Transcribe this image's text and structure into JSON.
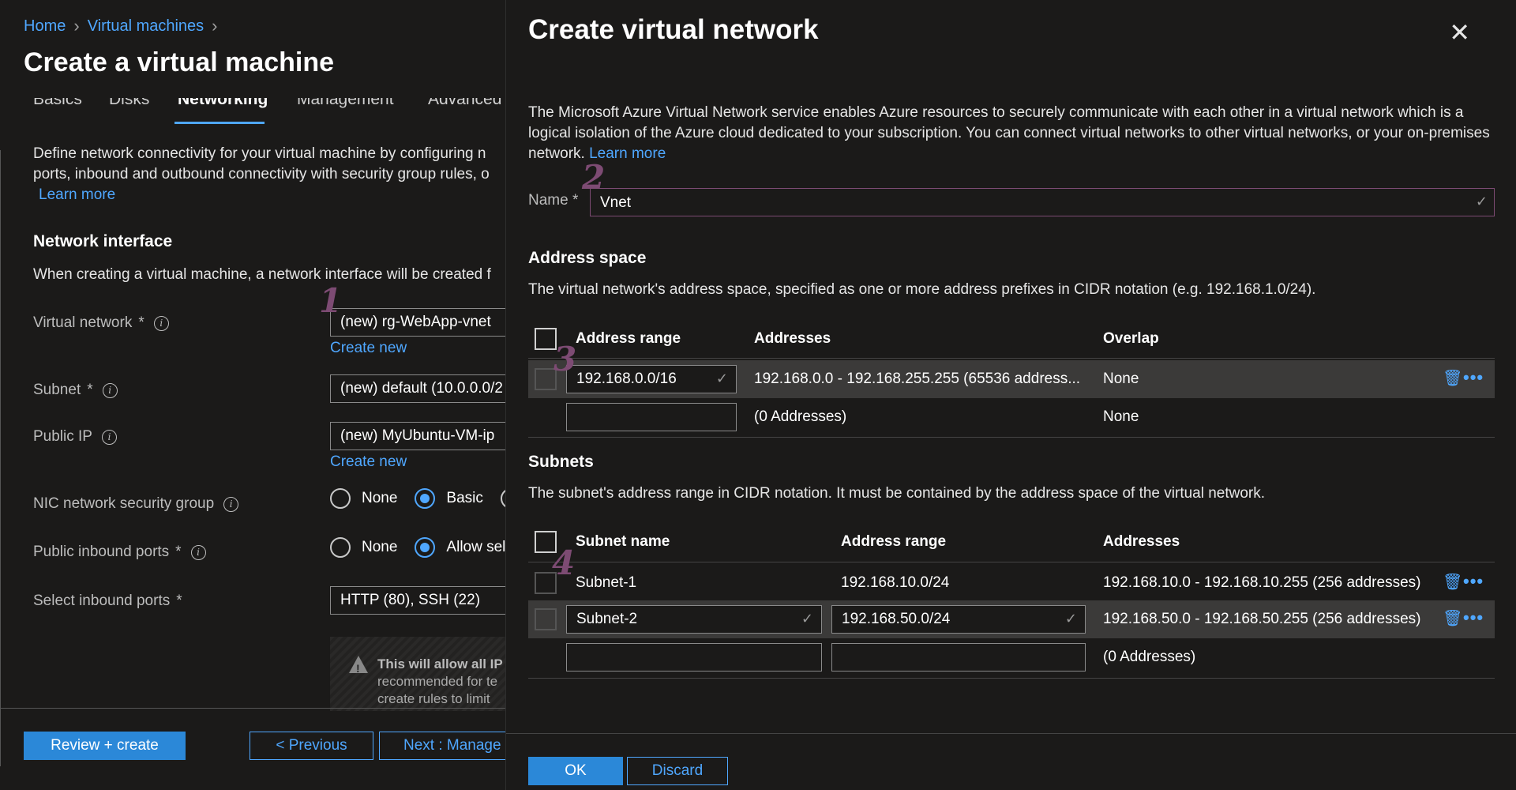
{
  "breadcrumb": {
    "home": "Home",
    "vms": "Virtual machines",
    "sep1": "›",
    "sep2": "›"
  },
  "left": {
    "title": "Create a virtual machine",
    "tabs": [
      "Basics",
      "Disks",
      "Networking",
      "Management",
      "Advanced"
    ],
    "desc_line1": "Define network connectivity for your virtual machine by configuring n",
    "desc_line2": "ports, inbound and outbound connectivity with security group rules, o",
    "learn_more": "Learn more",
    "network_interface_title": "Network interface",
    "network_interface_text": "When creating a virtual machine, a network interface will be created f",
    "fields": {
      "vnet_label": "Virtual network",
      "vnet_value": "(new) rg-WebApp-vnet",
      "subnet_label": "Subnet",
      "subnet_value": "(new) default (10.0.0.0/2",
      "pip_label": "Public IP",
      "pip_value": "(new) MyUbuntu-VM-ip",
      "nsg_label": "NIC network security group",
      "nsg_none": "None",
      "nsg_basic": "Basic",
      "inbound_label": "Public inbound ports",
      "inbound_none": "None",
      "inbound_allow": "Allow sel",
      "select_ports_label": "Select inbound ports",
      "select_ports_value": "HTTP (80), SSH (22)",
      "required_mark": "*",
      "create_new": "Create new"
    },
    "warning": {
      "title": "This will allow all IP",
      "line2": "recommended for te",
      "line3": "create rules to limit"
    },
    "buttons": {
      "review": "Review + create",
      "previous": "< Previous",
      "next": "Next : Manage"
    }
  },
  "annotations": [
    "1",
    "2",
    "3",
    "4"
  ],
  "panel": {
    "title": "Create virtual network",
    "close": "✕",
    "desc": "The Microsoft Azure Virtual Network service enables Azure resources to securely communicate with each other in a virtual network which is a logical isolation of the Azure cloud dedicated to your subscription. You can connect virtual networks to other virtual networks, or your on-premises network.",
    "learn_more": "Learn more",
    "name_label": "Name",
    "required_mark": "*",
    "name_value": "Vnet",
    "address_space": {
      "title": "Address space",
      "text": "The virtual network's address space, specified as one or more address prefixes in CIDR notation (e.g. 192.168.1.0/24).",
      "headers": [
        "Address range",
        "Addresses",
        "Overlap"
      ],
      "rows": [
        {
          "range": "192.168.0.0/16",
          "addresses": "192.168.0.0 - 192.168.255.255 (65536 address...",
          "overlap": "None"
        },
        {
          "range": "",
          "addresses": "(0 Addresses)",
          "overlap": "None"
        }
      ]
    },
    "subnets": {
      "title": "Subnets",
      "text": "The subnet's address range in CIDR notation. It must be contained by the address space of the virtual network.",
      "headers": [
        "Subnet name",
        "Address range",
        "Addresses"
      ],
      "rows": [
        {
          "name": "Subnet-1",
          "range": "192.168.10.0/24",
          "addresses": "192.168.10.0 - 192.168.10.255 (256 addresses)"
        },
        {
          "name": "Subnet-2",
          "range": "192.168.50.0/24",
          "addresses": "192.168.50.0 - 192.168.50.255 (256 addresses)"
        },
        {
          "name": "",
          "range": "",
          "addresses": "(0 Addresses)"
        }
      ]
    },
    "buttons": {
      "ok": "OK",
      "discard": "Discard"
    }
  },
  "icons": {
    "check": "✓",
    "trash": "🗑",
    "more": "•••",
    "info": "i"
  },
  "colors": {
    "accent": "#4fa7ff",
    "primary_button": "#2b88d8",
    "annotation": "#7d4b73",
    "background": "#1b1a19"
  }
}
